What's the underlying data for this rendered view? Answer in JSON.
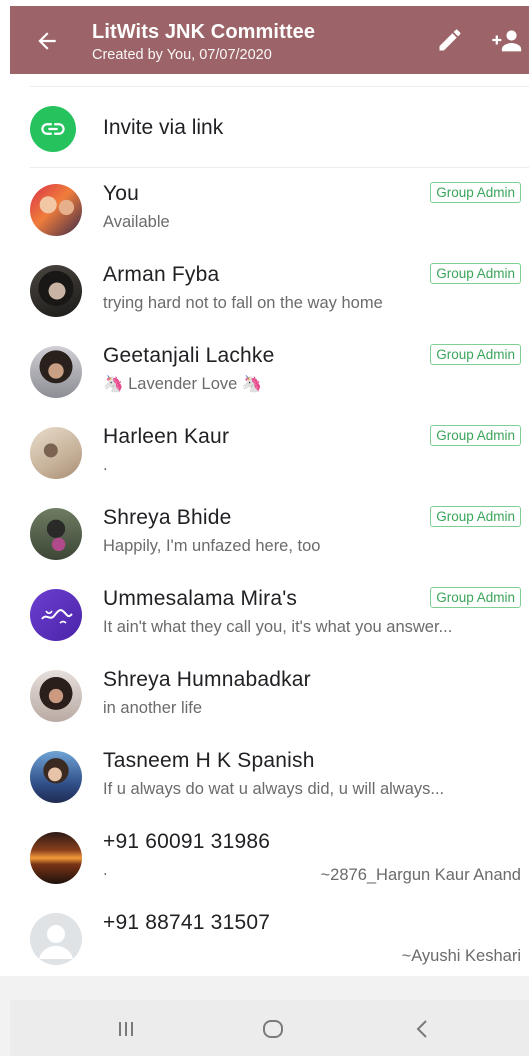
{
  "header": {
    "title": "LitWits JNK Committee",
    "subtitle": "Created by You, 07/07/2020",
    "background": "#9c6468",
    "icons": [
      "back-arrow-icon",
      "edit-icon",
      "add-participant-icon"
    ]
  },
  "invite": {
    "label": "Invite via link",
    "icon": "link-icon",
    "color": "#25c25e"
  },
  "members": [
    {
      "name": "You",
      "status": "Available",
      "badge": "Group Admin",
      "pushname": ""
    },
    {
      "name": "Arman Fyba",
      "status": "trying hard not to fall on the way home",
      "badge": "Group Admin",
      "pushname": ""
    },
    {
      "name": "Geetanjali Lachke",
      "status": "🦄 Lavender Love 🦄",
      "badge": "Group Admin",
      "pushname": ""
    },
    {
      "name": "Harleen Kaur",
      "status": ".",
      "badge": "Group Admin",
      "pushname": ""
    },
    {
      "name": "Shreya Bhide",
      "status": "Happily, I'm unfazed here, too",
      "badge": "Group Admin",
      "pushname": ""
    },
    {
      "name": "Ummesalama Mira's",
      "status": "It ain't what they call you, it's what you answer...",
      "badge": "Group Admin",
      "pushname": ""
    },
    {
      "name": "Shreya Humnabadkar",
      "status": "in another life",
      "badge": "",
      "pushname": ""
    },
    {
      "name": "Tasneem H K Spanish",
      "status": "If u always do wat u always did, u will always...",
      "badge": "",
      "pushname": ""
    },
    {
      "name": "+91 60091 31986",
      "status": ".",
      "badge": "",
      "pushname": "~2876_Hargun Kaur Anand"
    },
    {
      "name": "+91 88741 31507",
      "status": "",
      "badge": "",
      "pushname": "~Ayushi Keshari"
    }
  ],
  "navbar": {
    "icons": [
      "recent-apps-icon",
      "home-icon",
      "back-icon"
    ]
  },
  "colors": {
    "admin_badge": "#3aa55a",
    "secondary_text": "#6b6b6b"
  }
}
